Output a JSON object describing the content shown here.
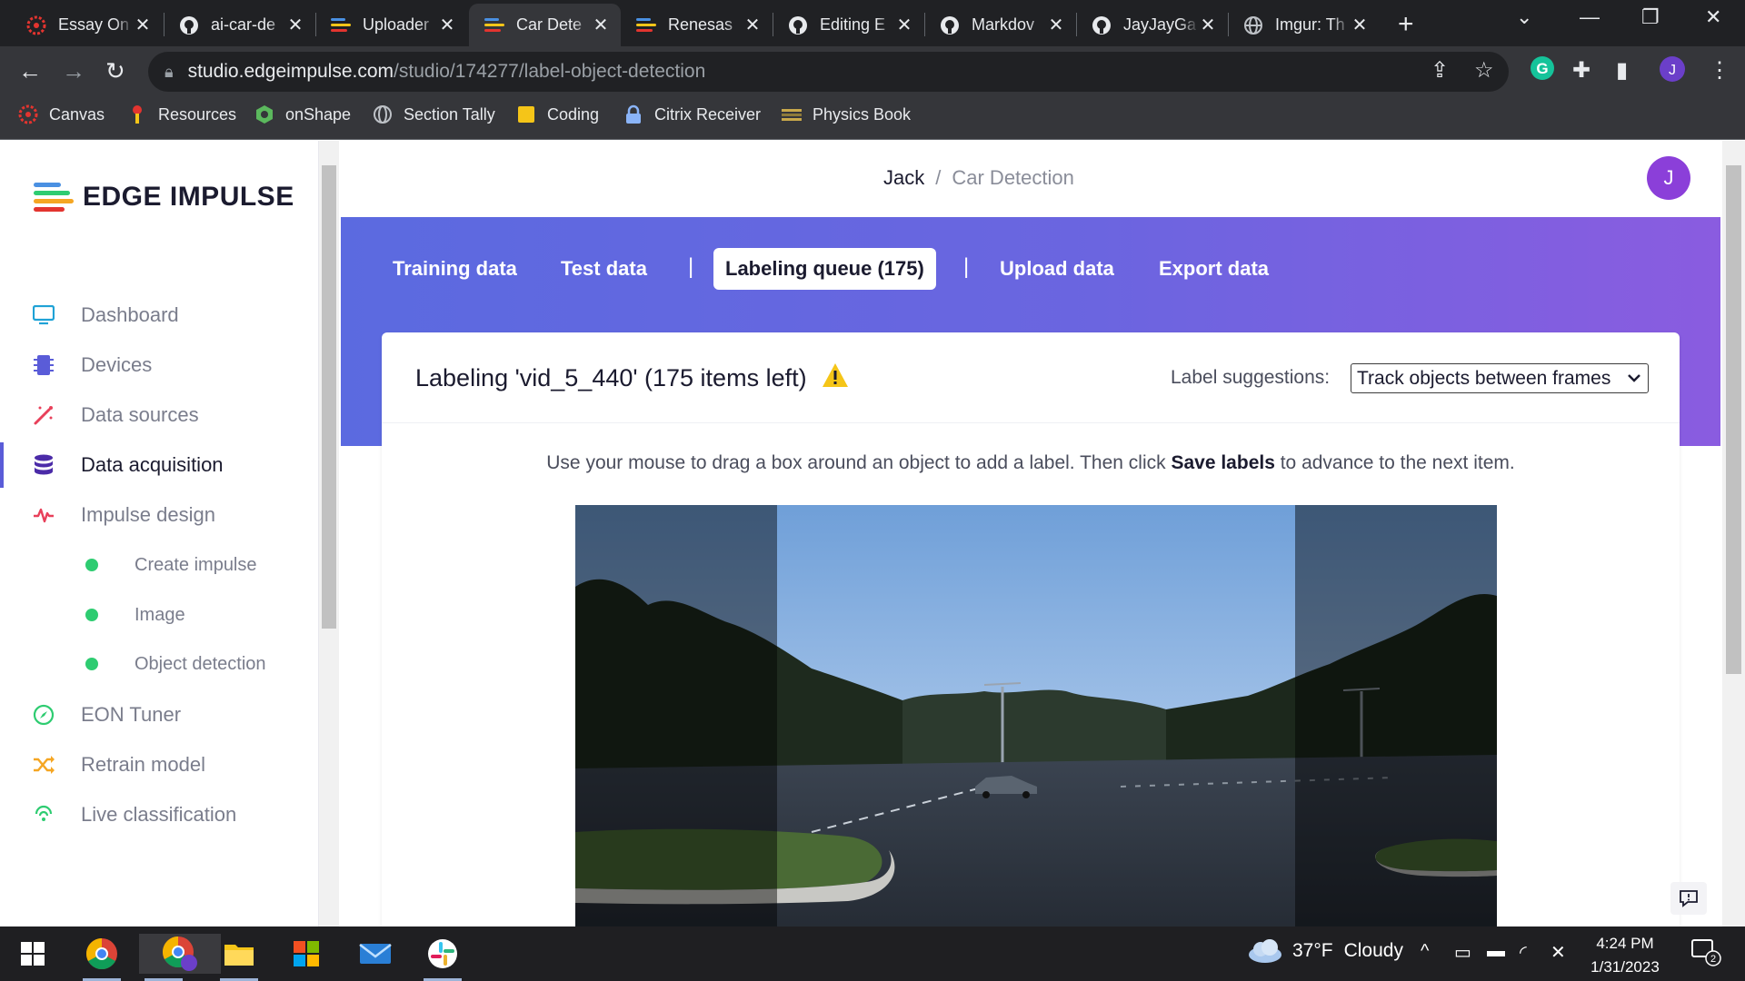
{
  "browser": {
    "tabs": [
      {
        "title": "Essay On",
        "icon": "canvas-icon"
      },
      {
        "title": "ai-car-de",
        "icon": "github-icon"
      },
      {
        "title": "Uploader",
        "icon": "edge-impulse-icon"
      },
      {
        "title": "Car Dete",
        "icon": "edge-impulse-icon",
        "active": true
      },
      {
        "title": "Renesas",
        "icon": "edge-impulse-icon"
      },
      {
        "title": "Editing E",
        "icon": "github-icon"
      },
      {
        "title": "Markdov",
        "icon": "github-icon"
      },
      {
        "title": "JayJayGa",
        "icon": "github-icon"
      },
      {
        "title": "Imgur: Th",
        "icon": "globe-icon"
      }
    ],
    "url_host": "studio.edgeimpulse.com",
    "url_path": "/studio/174277/label-object-detection",
    "profile_initial": "J",
    "extension_initial": "G",
    "bookmarks": [
      {
        "label": "Canvas",
        "icon": "canvas-icon"
      },
      {
        "label": "Resources",
        "icon": "resources-icon"
      },
      {
        "label": "onShape",
        "icon": "onshape-icon"
      },
      {
        "label": "Section Tally",
        "icon": "globe-icon"
      },
      {
        "label": "Coding",
        "icon": "folder-icon"
      },
      {
        "label": "Citrix Receiver",
        "icon": "citrix-icon"
      },
      {
        "label": "Physics Book",
        "icon": "book-icon"
      }
    ]
  },
  "sidebar": {
    "brand": "EDGE IMPULSE",
    "items": [
      {
        "label": "Dashboard",
        "icon": "monitor-icon"
      },
      {
        "label": "Devices",
        "icon": "chip-icon"
      },
      {
        "label": "Data sources",
        "icon": "wand-icon"
      },
      {
        "label": "Data acquisition",
        "icon": "database-icon",
        "active": true
      },
      {
        "label": "Impulse design",
        "icon": "pulse-icon"
      },
      {
        "label": "Create impulse",
        "sub": true
      },
      {
        "label": "Image",
        "sub": true
      },
      {
        "label": "Object detection",
        "sub": true
      },
      {
        "label": "EON Tuner",
        "icon": "compass-icon"
      },
      {
        "label": "Retrain model",
        "icon": "shuffle-icon"
      },
      {
        "label": "Live classification",
        "icon": "live-icon"
      }
    ]
  },
  "header": {
    "user": "Jack",
    "project": "Car Detection",
    "avatar_initial": "J"
  },
  "subnav": {
    "training": "Training data",
    "test": "Test data",
    "queue": "Labeling queue (175)",
    "upload": "Upload data",
    "export": "Export data"
  },
  "labeling": {
    "title": "Labeling 'vid_5_440' (175 items left)",
    "suggestions_label": "Label suggestions:",
    "suggestions_value": "Track objects between frames",
    "hint_pre": "Use your mouse to drag a box around an object to add a label. Then click ",
    "hint_bold": "Save labels",
    "hint_post": " to advance to the next item."
  },
  "taskbar": {
    "weather_temp": "37°F",
    "weather_text": "Cloudy",
    "time": "4:24 PM",
    "date": "1/31/2023",
    "notifications": "2"
  },
  "colors": {
    "accent": "#5a5cd8",
    "hero_start": "#5b6ae0",
    "hero_end": "#8a5ce0",
    "avatar": "#8b3fd9",
    "sub_dot": "#2ecc71",
    "warning": "#f5c518"
  }
}
